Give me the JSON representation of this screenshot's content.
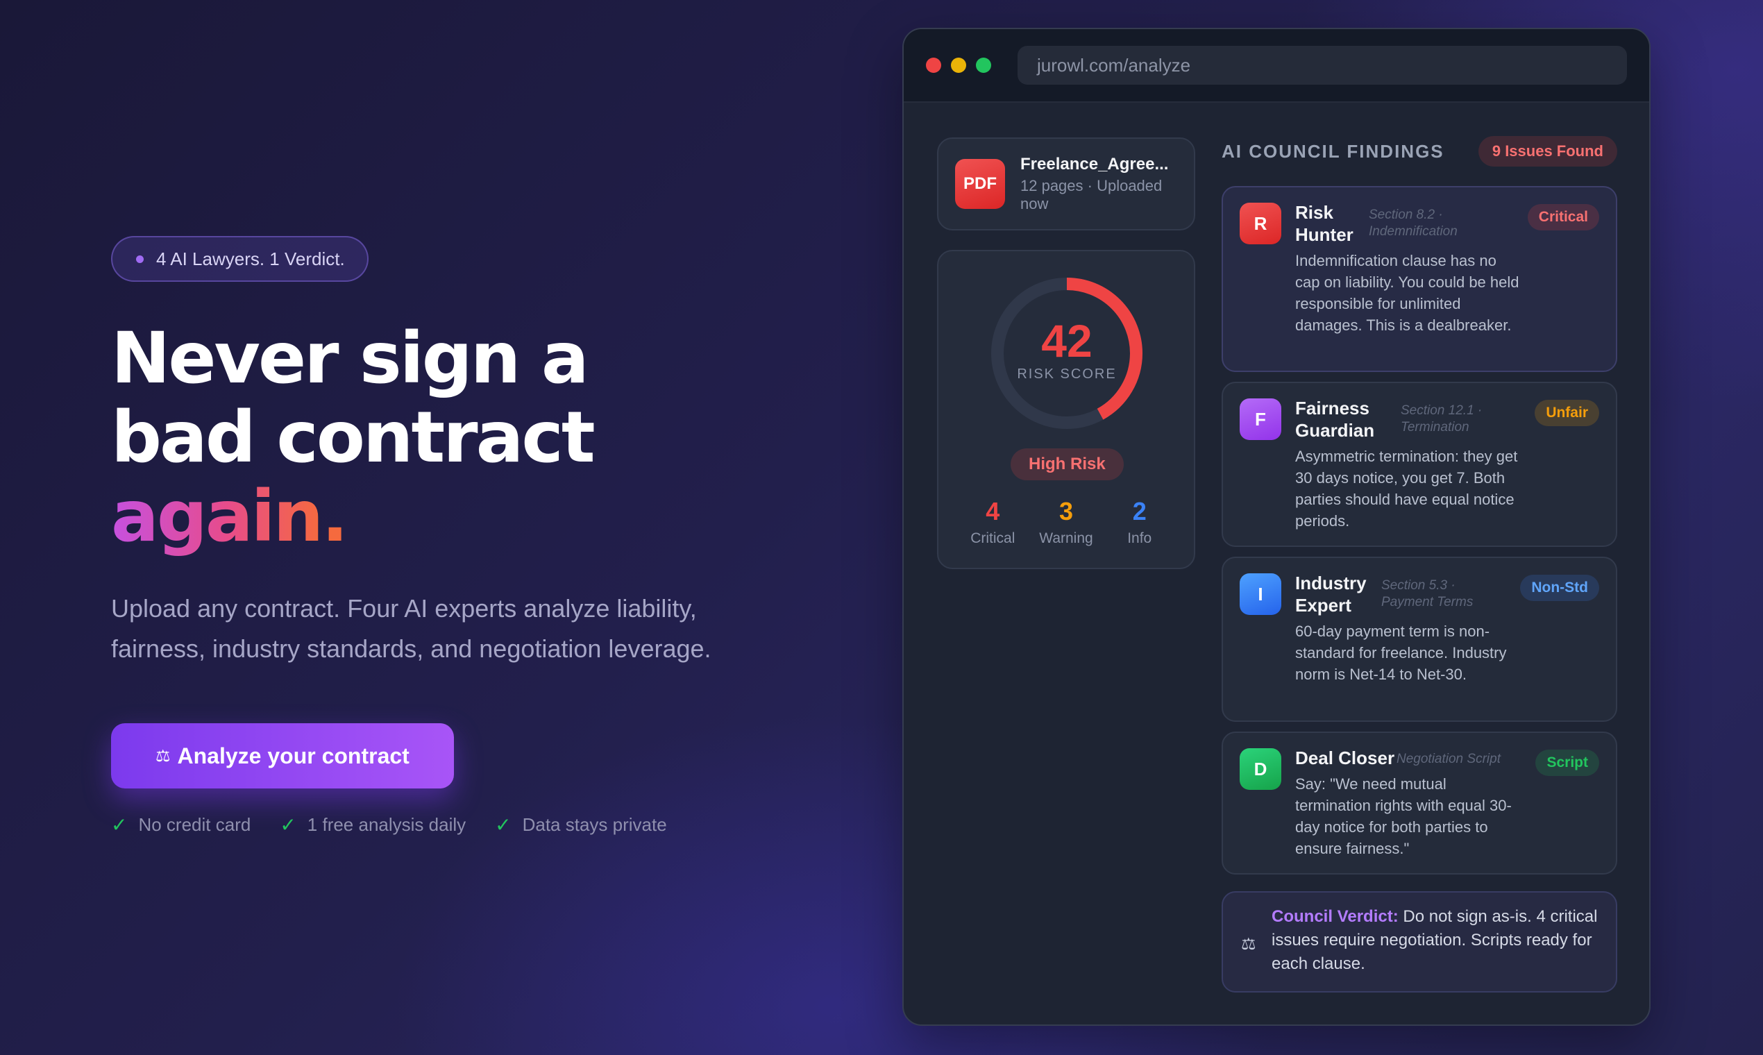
{
  "hero": {
    "badge": "4 AI Lawyers. 1 Verdict.",
    "headline_line1": "Never sign a",
    "headline_line2": "bad contract",
    "headline_accent": "again",
    "headline_period": ".",
    "subtitle_line1": "Upload any contract. Four AI experts analyze liability,",
    "subtitle_line2": "fairness, industry standards, and negotiation leverage.",
    "cta_icon": "⚖",
    "cta_label": "Analyze your contract",
    "perks": [
      "No credit card",
      "1 free analysis daily",
      "Data stays private"
    ]
  },
  "browser": {
    "url": "jurowl.com/analyze"
  },
  "file": {
    "badge": "PDF",
    "name": "Freelance_Agree...",
    "meta": "12 pages · Uploaded now"
  },
  "score": {
    "value": "42",
    "fraction": 0.42,
    "label": "RISK SCORE",
    "level": "High Risk",
    "counts": [
      {
        "num": "4",
        "label": "Critical",
        "color": "#ef4444"
      },
      {
        "num": "3",
        "label": "Warning",
        "color": "#f59e0b"
      },
      {
        "num": "2",
        "label": "Info",
        "color": "#3b82f6"
      }
    ]
  },
  "findings": {
    "title": "AI COUNCIL FINDINGS",
    "issues": "9 Issues Found",
    "items": [
      {
        "initial": "R",
        "name": "Risk Hunter",
        "section": "Section 8.2 · Indemnification",
        "tag": "Critical",
        "tag_color": "#f87171",
        "avatar_color": "#ef4444",
        "text": "Indemnification clause has no cap on liability. You could be held responsible for unlimited damages. This is a dealbreaker."
      },
      {
        "initial": "F",
        "name": "Fairness Guardian",
        "section": "Section 12.1 · Termination",
        "tag": "Unfair",
        "tag_color": "#f59e0b",
        "avatar_color": "#a855f7",
        "text": "Asymmetric termination: they get 30 days notice, you get 7. Both parties should have equal notice periods."
      },
      {
        "initial": "I",
        "name": "Industry Expert",
        "section": "Section 5.3 · Payment Terms",
        "tag": "Non-Std",
        "tag_color": "#60a5fa",
        "avatar_color": "#3b82f6",
        "text": "60-day payment term is non-standard for freelance. Industry norm is Net-14 to Net-30."
      },
      {
        "initial": "D",
        "name": "Deal Closer",
        "section": "Negotiation Script",
        "tag": "Script",
        "tag_color": "#22c55e",
        "avatar_color": "#22c55e",
        "text": "Say: \"We need mutual termination rights with equal 30-day notice for both parties to ensure fairness.\""
      }
    ]
  },
  "verdict": {
    "icon": "⚖",
    "label": "Council Verdict:",
    "text": " Do not sign as-is. 4 critical issues require negotiation. Scripts ready for each clause."
  }
}
